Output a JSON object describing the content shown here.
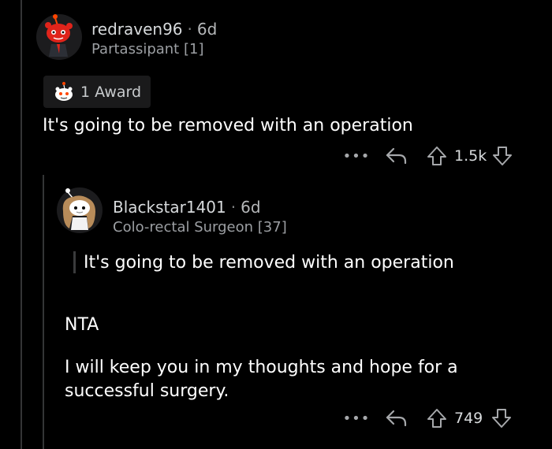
{
  "comments": [
    {
      "username": "redraven96",
      "age": "6d",
      "flair": "Partassipant [1]",
      "award_label": "1 Award",
      "body": "It's going to be removed with an operation",
      "score": "1.5k",
      "more_label": "•••",
      "avatar_icon": "snoo-red-avatar-icon"
    },
    {
      "username": "Blackstar1401",
      "age": "6d",
      "flair": "Colo-rectal Surgeon [37]",
      "quote": "It's going to be removed with an operation",
      "body_line1": "NTA",
      "body_line2": "I will keep you in my thoughts and hope for a successful surgery.",
      "score": "749",
      "more_label": "•••",
      "avatar_icon": "snoo-curly-hair-avatar-icon"
    }
  ],
  "colors": {
    "background": "#000000",
    "text": "#ffffff",
    "muted": "#9c9fa3",
    "thread_line": "#343536"
  }
}
